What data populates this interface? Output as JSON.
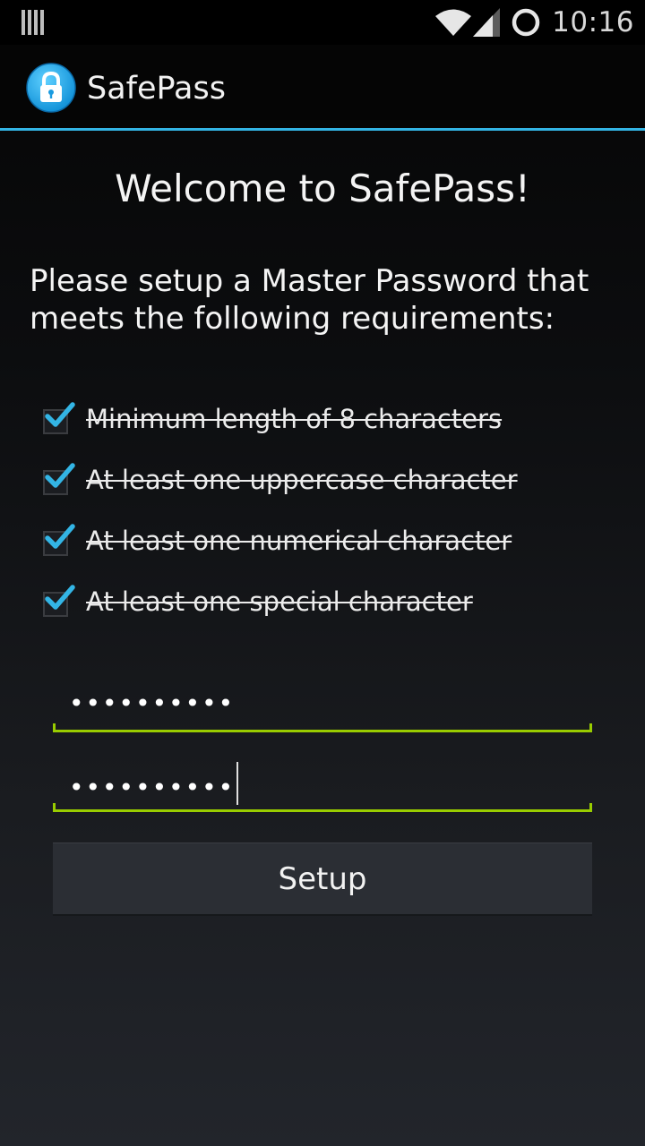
{
  "status_bar": {
    "time": "10:16",
    "left_icon": "signal-strength-icon",
    "icons": [
      "wifi-icon",
      "cell-signal-icon",
      "ring-icon"
    ]
  },
  "action_bar": {
    "app_icon": "lock-icon",
    "title": "SafePass"
  },
  "main": {
    "welcome": "Welcome to SafePass!",
    "instruction": "Please setup a Master Password that meets the following requirements:",
    "requirements": [
      {
        "label": "Minimum length of 8 characters",
        "checked": true
      },
      {
        "label": "At least one uppercase character",
        "checked": true
      },
      {
        "label": "At least one numerical character",
        "checked": true
      },
      {
        "label": "At least one special character",
        "checked": true
      }
    ],
    "password_value": "••••••••••",
    "confirm_password_value": "••••••••••",
    "setup_label": "Setup"
  },
  "colors": {
    "accent_blue": "#33b5e5",
    "field_underline": "#99cc00",
    "checkmark": "#33b5e5"
  }
}
